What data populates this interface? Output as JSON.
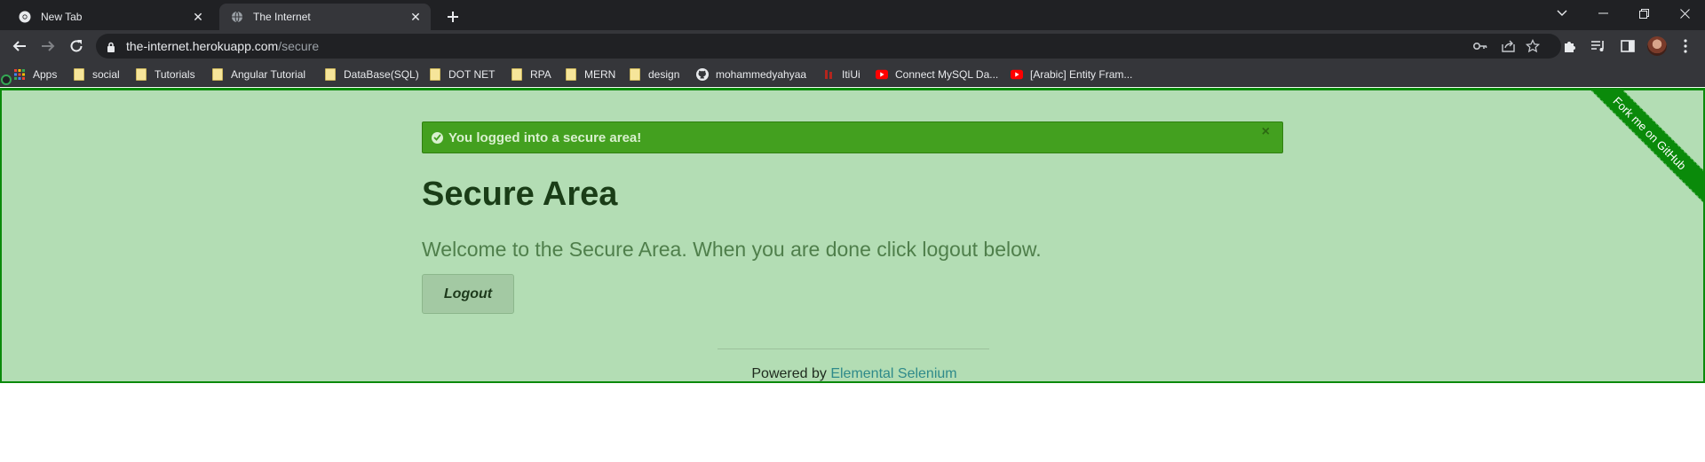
{
  "tabs": [
    {
      "title": "New Tab",
      "icon": "chrome-icon"
    },
    {
      "title": "The Internet",
      "icon": "globe-icon"
    }
  ],
  "omnibox": {
    "host": "the-internet.herokuapp.com",
    "path": "/secure"
  },
  "bookmarks": [
    {
      "label": "Apps",
      "icon": "apps-grid-icon"
    },
    {
      "label": "social",
      "icon": "folder-icon"
    },
    {
      "label": "Tutorials",
      "icon": "folder-icon"
    },
    {
      "label": "Angular Tutorial",
      "icon": "folder-icon"
    },
    {
      "label": "DataBase(SQL)",
      "icon": "folder-icon"
    },
    {
      "label": "DOT NET",
      "icon": "folder-icon"
    },
    {
      "label": "RPA",
      "icon": "folder-icon"
    },
    {
      "label": "MERN",
      "icon": "folder-icon"
    },
    {
      "label": "design",
      "icon": "folder-icon"
    },
    {
      "label": "mohammedyahyaa",
      "icon": "github-icon"
    },
    {
      "label": "ItiUi",
      "icon": "iti-icon"
    },
    {
      "label": "Connect MySQL Da...",
      "icon": "youtube-icon"
    },
    {
      "label": "[Arabic] Entity Fram...",
      "icon": "youtube-icon"
    }
  ],
  "page": {
    "flash": {
      "message": "You logged into a secure area!",
      "close": "×"
    },
    "heading": "Secure Area",
    "subheader": "Welcome to the Secure Area. When you are done click logout below.",
    "logout_label": "Logout",
    "footer": {
      "prefix": "Powered by",
      "link": "Elemental Selenium"
    },
    "ribbon": "Fork me on GitHub"
  },
  "colors": {
    "page_bg": "#b3ddb4",
    "flash_bg": "#43a01f",
    "ribbon": "#0a8a0a",
    "chrome_dark": "#202124",
    "chrome_toolbar": "#35363a"
  }
}
